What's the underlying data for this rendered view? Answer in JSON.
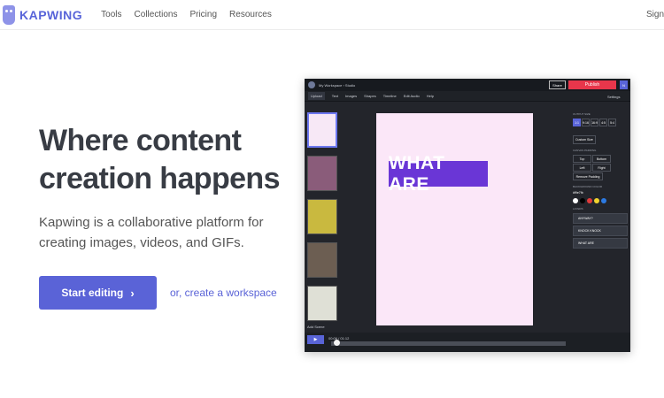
{
  "nav": {
    "brand": "KAPWING",
    "links": [
      "Tools",
      "Collections",
      "Pricing",
      "Resources"
    ],
    "signin": "Sign"
  },
  "hero": {
    "title": "Where content creation happens",
    "subtitle": "Kapwing is a collaborative platform for creating images, videos, and GIFs.",
    "cta_label": "Start editing",
    "cta_icon": "chevron-right-icon",
    "secondary_link": "or, create a workspace"
  },
  "editor": {
    "breadcrumb": "My Workspace › Studio",
    "share": "Share",
    "publish": "Publish",
    "user": "N",
    "tools": [
      "Upload",
      "Text",
      "Images",
      "Shapes",
      "Timeline",
      "Edit Audio",
      "Help"
    ],
    "settings": "Settings",
    "add_scene": "Add Scene",
    "canvas_text": "WHAT ARE",
    "output_label": "OUTPUT SIZE",
    "ratios": [
      "1:1",
      "9:16",
      "16:9",
      "4:5",
      "5:4"
    ],
    "custom_size": "Custom Size",
    "canvas_label": "CANVAS PADDING",
    "padding_options": [
      "Top",
      "Bottom",
      "Left",
      "Right",
      "Remove Padding"
    ],
    "bg_label": "BACKGROUND COLOR",
    "bg_value": "#f9e7fb",
    "swatches": [
      "#ffffff",
      "#000000",
      "#e13b3b",
      "#f0d22e",
      "#2c7ae2"
    ],
    "layers_label": "LAYERS",
    "layers": [
      "ANYWAY?",
      "KNOCK KNOCK",
      "WHAT ARE"
    ],
    "time": "00:06 / 01:12",
    "progress": 0.03
  },
  "colors": {
    "brand": "#5864d9",
    "publish": "#e8364b",
    "canvas": "#fbe7f8",
    "canvas_text_bg": "#6a36d6"
  }
}
